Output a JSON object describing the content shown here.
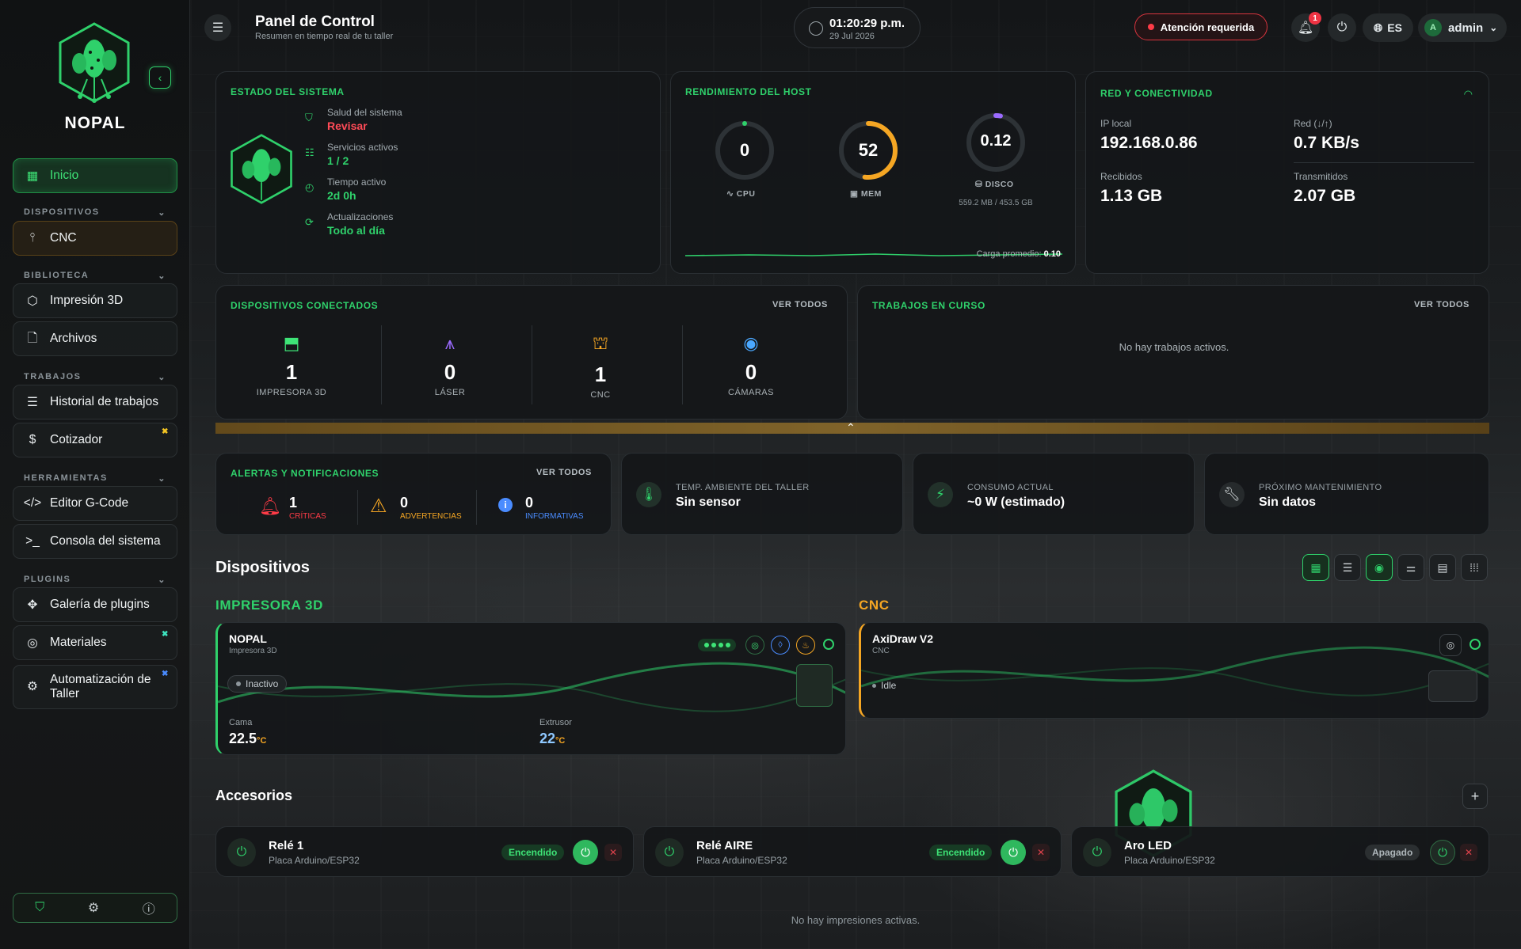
{
  "sidebar": {
    "brand": "NOPAL",
    "items": [
      {
        "label": "Inicio"
      },
      {
        "section": "DISPOSITIVOS"
      },
      {
        "label": "CNC"
      },
      {
        "section": "BIBLIOTECA"
      },
      {
        "label": "Impresión 3D"
      },
      {
        "label": "Archivos"
      },
      {
        "section": "TRABAJOS"
      },
      {
        "label": "Historial de trabajos"
      },
      {
        "label": "Cotizador"
      },
      {
        "section": "HERRAMIENTAS"
      },
      {
        "label": "Editor G-Code"
      },
      {
        "label": "Consola del sistema"
      },
      {
        "section": "PLUGINS"
      },
      {
        "label": "Galería de plugins"
      },
      {
        "label": "Materiales"
      },
      {
        "label": "Automatización de Taller"
      }
    ]
  },
  "header": {
    "title": "Panel de Control",
    "subtitle": "Resumen en tiempo real de tu taller",
    "time": "01:20:29 p.m.",
    "date": "29 Jul 2026",
    "attention": "Atención requerida",
    "notifications": "1",
    "language": "ES",
    "user": "admin",
    "avatar": "A"
  },
  "system": {
    "title": "ESTADO DEL SISTEMA",
    "rows": [
      {
        "label": "Salud del sistema",
        "value": "Revisar",
        "color": "#ff4b57"
      },
      {
        "label": "Servicios activos",
        "value": "1 / 2",
        "color": "#2fd16b"
      },
      {
        "label": "Tiempo activo",
        "value": "2d 0h",
        "color": "#2fd16b"
      },
      {
        "label": "Actualizaciones",
        "value": "Todo al día",
        "color": "#2fd16b"
      }
    ]
  },
  "host": {
    "title": "RENDIMIENTO DEL HOST",
    "cpu": {
      "value": "0",
      "label": "CPU",
      "pct": 0
    },
    "mem": {
      "value": "52",
      "label": "MEM",
      "pct": 52,
      "color": "#f5a623"
    },
    "disk": {
      "value": "0.12",
      "label": "DISCO",
      "pct": 0.12,
      "color": "#9b6bff",
      "detail": "559.2 MB / 453.5 GB"
    },
    "load_label": "Carga promedio:",
    "load_value": "0.10"
  },
  "network": {
    "title": "RED Y CONECTIVIDAD",
    "ip_label": "IP local",
    "ip": "192.168.0.86",
    "net_label": "Red (↓/↑)",
    "net": "0.7 KB/s",
    "rx_label": "Recibidos",
    "rx": "1.13 GB",
    "tx_label": "Transmitidos",
    "tx": "2.07 GB"
  },
  "devices": {
    "title": "DISPOSITIVOS CONECTADOS",
    "view_all": "VER TODOS",
    "items": [
      {
        "count": "1",
        "label": "IMPRESORA 3D",
        "color": "#3ee477"
      },
      {
        "count": "0",
        "label": "LÁSER",
        "color": "#9b6bff"
      },
      {
        "count": "1",
        "label": "CNC",
        "color": "#f5a623"
      },
      {
        "count": "0",
        "label": "CÁMARAS",
        "color": "#4aa8ff"
      }
    ]
  },
  "jobs": {
    "title": "TRABAJOS EN CURSO",
    "view_all": "VER TODOS",
    "empty": "No hay trabajos activos."
  },
  "alerts": {
    "title": "ALERTAS Y NOTIFICACIONES",
    "view_all": "VER TODOS",
    "critical": {
      "count": "1",
      "label": "CRÍTICAS",
      "color": "#ff3b47"
    },
    "warnings": {
      "count": "0",
      "label": "ADVERTENCIAS",
      "color": "#f5a623"
    },
    "info": {
      "count": "0",
      "label": "INFORMATIVAS",
      "color": "#4a8cff"
    }
  },
  "ambient": {
    "label": "TEMP. AMBIENTE DEL TALLER",
    "value": "Sin sensor"
  },
  "power": {
    "label": "CONSUMO ACTUAL",
    "value": "~0 W (estimado)"
  },
  "maintenance": {
    "label": "PRÓXIMO MANTENIMIENTO",
    "value": "Sin datos"
  },
  "devices_section": {
    "title": "Dispositivos",
    "printer_cat": "IMPRESORA 3D",
    "cnc_cat": "CNC",
    "printer": {
      "name": "NOPAL",
      "type": "Impresora 3D",
      "status": "Inactivo",
      "bed_label": "Cama",
      "bed": "22.5",
      "ext_label": "Extrusor",
      "ext": "22",
      "unit": "°C"
    },
    "cnc": {
      "name": "AxiDraw V2",
      "type": "CNC",
      "status": "Idle"
    }
  },
  "accessories": {
    "title": "Accesorios",
    "items": [
      {
        "name": "Relé 1",
        "sub": "Placa Arduino/ESP32",
        "state": "Encendido"
      },
      {
        "name": "Relé AIRE",
        "sub": "Placa Arduino/ESP32",
        "state": "Encendido"
      },
      {
        "name": "Aro LED",
        "sub": "Placa Arduino/ESP32",
        "state": "Apagado"
      }
    ]
  },
  "footer": {
    "empty": "No hay impresiones activas."
  }
}
